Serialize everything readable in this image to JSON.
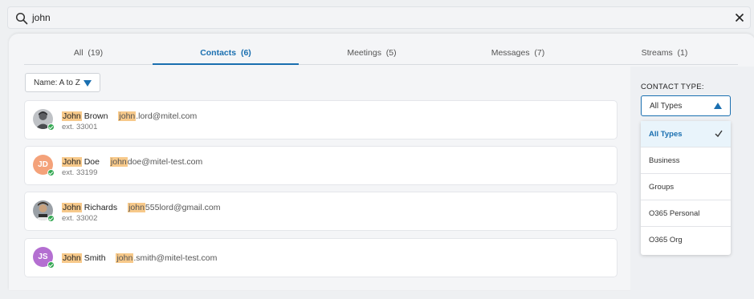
{
  "search": {
    "query": "john"
  },
  "tabs": [
    {
      "label": "All",
      "count": "(19)"
    },
    {
      "label": "Contacts",
      "count": "(6)"
    },
    {
      "label": "Meetings",
      "count": "(5)"
    },
    {
      "label": "Messages",
      "count": "(7)"
    },
    {
      "label": "Streams",
      "count": "(1)"
    }
  ],
  "sort": {
    "label": "Name: A to Z"
  },
  "contacts": [
    {
      "first": "John",
      "last": "Brown",
      "email_hl": "john",
      "email_rest": ".lord@mitel.com",
      "ext": "ext. 33001"
    },
    {
      "first": "John",
      "last": "Doe",
      "initials": "JD",
      "email_hl": "john",
      "email_rest": "doe@mitel-test.com",
      "ext": "ext. 33199"
    },
    {
      "first": "John",
      "last": "Richards",
      "email_hl": "john",
      "email_rest": "555lord@gmail.com",
      "ext": "ext. 33002"
    },
    {
      "first": "John",
      "last": "Smith",
      "initials": "JS",
      "email_hl": "john",
      "email_rest": ".smith@mitel-test.com"
    }
  ],
  "filter": {
    "title": "CONTACT TYPE:",
    "selected": "All Types",
    "options": [
      "All Types",
      "Business",
      "Groups",
      "O365 Personal",
      "O365 Org"
    ]
  },
  "colors": {
    "accent": "#1a6fb0",
    "highlight": "#f7c98a",
    "presence": "#34a853",
    "jd_avatar": "#f4a27a",
    "js_avatar": "#b46fd1"
  }
}
